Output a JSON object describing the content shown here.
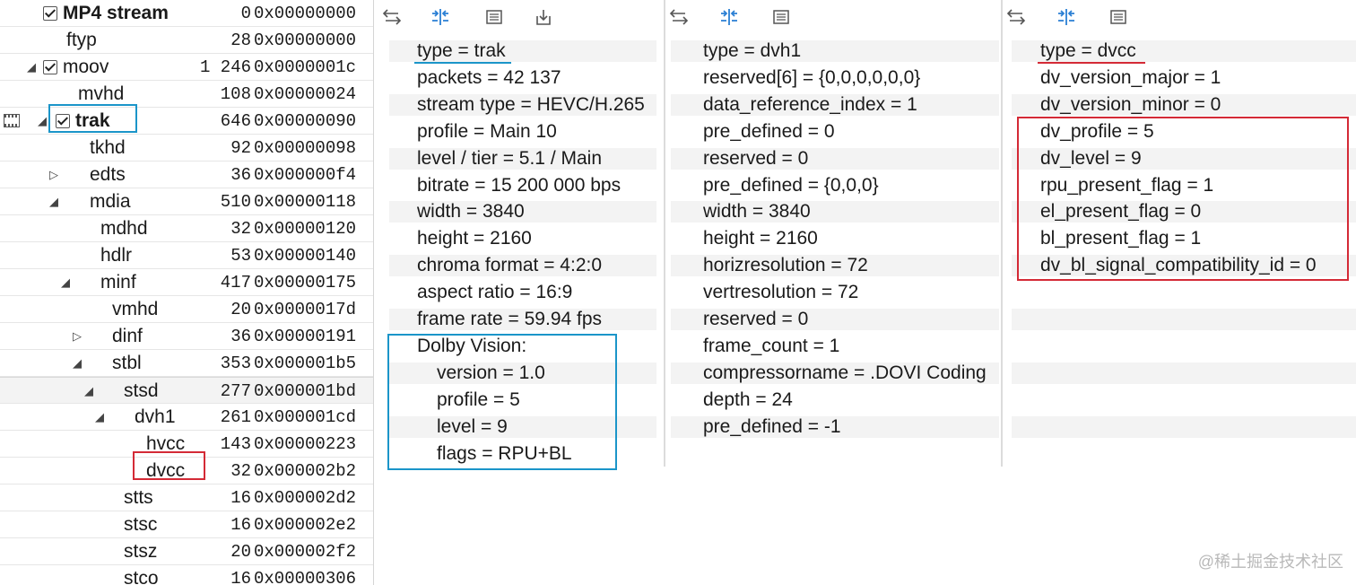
{
  "tree": {
    "rows": [
      {
        "name": "MP4 stream",
        "size": "0",
        "offset": "0x00000000"
      },
      {
        "name": "ftyp",
        "size": "28",
        "offset": "0x00000000"
      },
      {
        "name": "moov",
        "size": "1 246",
        "offset": "0x0000001c"
      },
      {
        "name": "mvhd",
        "size": "108",
        "offset": "0x00000024"
      },
      {
        "name": "trak",
        "size": "646",
        "offset": "0x00000090"
      },
      {
        "name": "tkhd",
        "size": "92",
        "offset": "0x00000098"
      },
      {
        "name": "edts",
        "size": "36",
        "offset": "0x000000f4"
      },
      {
        "name": "mdia",
        "size": "510",
        "offset": "0x00000118"
      },
      {
        "name": "mdhd",
        "size": "32",
        "offset": "0x00000120"
      },
      {
        "name": "hdlr",
        "size": "53",
        "offset": "0x00000140"
      },
      {
        "name": "minf",
        "size": "417",
        "offset": "0x00000175"
      },
      {
        "name": "vmhd",
        "size": "20",
        "offset": "0x0000017d"
      },
      {
        "name": "dinf",
        "size": "36",
        "offset": "0x00000191"
      },
      {
        "name": "stbl",
        "size": "353",
        "offset": "0x000001b5"
      },
      {
        "name": "stsd",
        "size": "277",
        "offset": "0x000001bd"
      },
      {
        "name": "dvh1",
        "size": "261",
        "offset": "0x000001cd"
      },
      {
        "name": "hvcc",
        "size": "143",
        "offset": "0x00000223"
      },
      {
        "name": "dvcc",
        "size": "32",
        "offset": "0x000002b2"
      },
      {
        "name": "stts",
        "size": "16",
        "offset": "0x000002d2"
      },
      {
        "name": "stsc",
        "size": "16",
        "offset": "0x000002e2"
      },
      {
        "name": "stsz",
        "size": "20",
        "offset": "0x000002f2"
      },
      {
        "name": "stco",
        "size": "16",
        "offset": "0x00000306"
      }
    ]
  },
  "panel_trak": {
    "lines": [
      "type = trak",
      "packets = 42 137",
      "stream type = HEVC/H.265",
      "profile = Main 10",
      "level / tier = 5.1 / Main",
      "bitrate = 15 200 000 bps",
      "width = 3840",
      "height = 2160",
      "chroma format = 4:2:0",
      "aspect ratio = 16:9",
      "frame rate = 59.94 fps",
      "Dolby Vision:",
      "version = 1.0",
      "profile = 5",
      "level = 9",
      "flags = RPU+BL"
    ]
  },
  "panel_dvh1": {
    "lines": [
      "type = dvh1",
      "reserved[6]  =  {0,0,0,0,0,0}",
      "data_reference_index  =  1",
      "pre_defined  =  0",
      "reserved  =  0",
      "pre_defined  =  {0,0,0}",
      "width  =  3840",
      "height  =  2160",
      "horizresolution  =  72",
      "vertresolution  =  72",
      "reserved  =  0",
      "frame_count  =  1",
      "compressorname  =  .DOVI Coding",
      "depth  =  24",
      "pre_defined  =  -1"
    ]
  },
  "panel_dvcc": {
    "lines": [
      "type = dvcc",
      "dv_version_major  =  1",
      "dv_version_minor  =  0",
      "dv_profile  =  5",
      "dv_level  =  9",
      "rpu_present_flag  =  1",
      "el_present_flag  =  0",
      "bl_present_flag  =  1",
      "dv_bl_signal_compatibility_id  =  0"
    ]
  },
  "toolbar": {
    "icons": [
      "sync-arrows-icon",
      "split-columns-icon",
      "list-view-icon",
      "export-icon"
    ]
  },
  "watermark": "@稀土掘金技术社区",
  "colors": {
    "accent_blue": "#1b95c9",
    "highlight_red": "#d42a36",
    "icon_blue": "#2a7fd4"
  }
}
